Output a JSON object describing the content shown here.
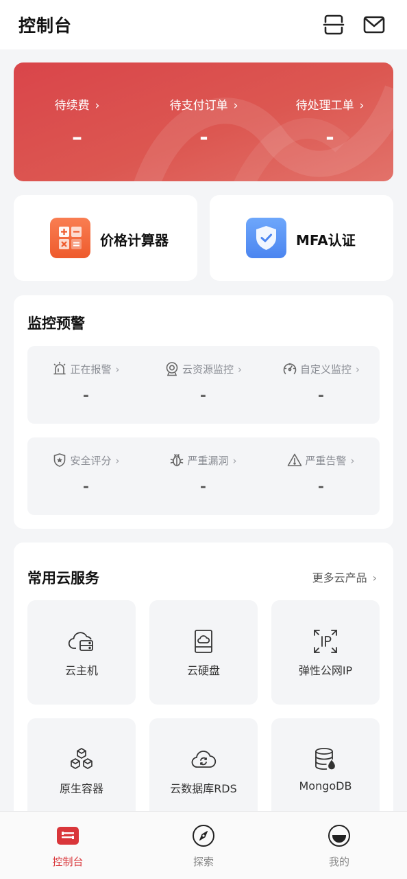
{
  "header": {
    "title": "控制台",
    "icons": [
      "scan-icon",
      "mail-icon"
    ]
  },
  "banner": {
    "accent_color": "#d9454a",
    "items": [
      {
        "label": "待续费",
        "value": "–"
      },
      {
        "label": "待支付订单",
        "value": "-"
      },
      {
        "label": "待处理工单",
        "value": "-"
      }
    ]
  },
  "tools": [
    {
      "label": "价格计算器",
      "icon": "calculator-icon",
      "color": "#f06a3a"
    },
    {
      "label": "MFA认证",
      "icon": "shield-check-icon",
      "color": "#5a93f5"
    }
  ],
  "monitor": {
    "title": "监控预警",
    "row1": [
      {
        "label": "正在报警",
        "value": "-",
        "icon": "alarm-icon"
      },
      {
        "label": "云资源监控",
        "value": "-",
        "icon": "webcam-icon"
      },
      {
        "label": "自定义监控",
        "value": "-",
        "icon": "gauge-icon"
      }
    ],
    "row2": [
      {
        "label": "安全评分",
        "value": "-",
        "icon": "shield-star-icon"
      },
      {
        "label": "严重漏洞",
        "value": "-",
        "icon": "bug-icon"
      },
      {
        "label": "严重告警",
        "value": "-",
        "icon": "warning-icon"
      }
    ]
  },
  "services": {
    "title": "常用云服务",
    "more_label": "更多云产品",
    "items": [
      {
        "name": "云主机",
        "icon": "cloud-server-icon"
      },
      {
        "name": "云硬盘",
        "icon": "cloud-disk-icon"
      },
      {
        "name": "弹性公网IP",
        "icon": "ip-icon"
      },
      {
        "name": "原生容器",
        "icon": "container-icon"
      },
      {
        "name": "云数据库RDS",
        "icon": "cloud-database-icon"
      },
      {
        "name": "MongoDB",
        "icon": "database-icon"
      }
    ]
  },
  "tabbar": {
    "active_color": "#d9363a",
    "tabs": [
      {
        "label": "控制台",
        "icon": "console-icon",
        "active": true
      },
      {
        "label": "探索",
        "icon": "compass-icon",
        "active": false
      },
      {
        "label": "我的",
        "icon": "profile-icon",
        "active": false
      }
    ]
  }
}
